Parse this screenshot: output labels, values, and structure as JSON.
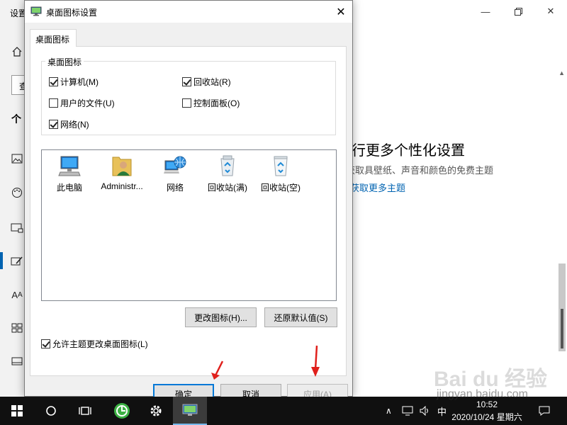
{
  "settings": {
    "title": "设置",
    "promo_title": "行更多个性化设置",
    "promo_desc": "获取具壁纸、声音和颜色的免费主题",
    "promo_link": "获取更多主题",
    "title_fragment_desc": "获取",
    "search_fragment": "查",
    "section_fragment": "个"
  },
  "dialog": {
    "title": "桌面图标设置",
    "close_glyph": "✕",
    "tab_label": "桌面图标",
    "group_label": "桌面图标",
    "checkboxes": [
      {
        "label": "计算机(M)",
        "checked": true
      },
      {
        "label": "回收站(R)",
        "checked": true
      },
      {
        "label": "用户的文件(U)",
        "checked": false
      },
      {
        "label": "控制面板(O)",
        "checked": false
      },
      {
        "label": "网络(N)",
        "checked": true
      }
    ],
    "icons": [
      {
        "label": "此电脑",
        "icon": "computer-icon"
      },
      {
        "label": "Administr...",
        "icon": "user-folder-icon"
      },
      {
        "label": "网络",
        "icon": "network-icon"
      },
      {
        "label": "回收站(满)",
        "icon": "recycle-bin-full-icon"
      },
      {
        "label": "回收站(空)",
        "icon": "recycle-bin-empty-icon"
      }
    ],
    "change_icon_label": "更改图标(H)...",
    "restore_default_label": "还原默认值(S)",
    "allow_theme_label": "允许主题更改桌面图标(L)",
    "allow_theme_checked": true,
    "ok_label": "确定",
    "cancel_label": "取消",
    "apply_label": "应用(A)"
  },
  "annotations": {
    "arrow_color": "#e0201c"
  },
  "taskbar": {
    "time": "10:52",
    "date": "2020/10/24 星期六",
    "ime": "中",
    "tray_up": "∧"
  },
  "watermark": {
    "text": "Bai du 经验",
    "url": "jingyan.baidu.com"
  }
}
